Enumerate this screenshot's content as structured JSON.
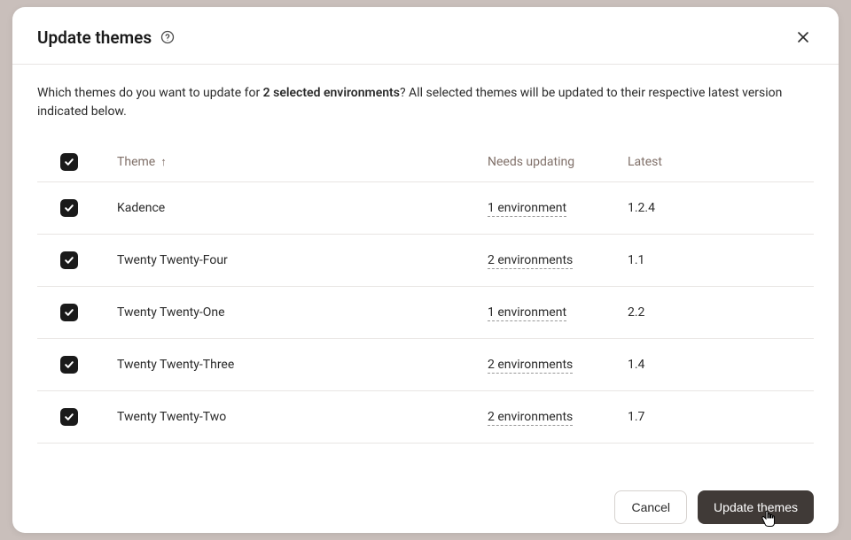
{
  "modal": {
    "title": "Update themes",
    "description_prefix": "Which themes do you want to update for ",
    "description_bold": "2 selected environments",
    "description_suffix": "? All selected themes will be updated to their respective latest version indicated below."
  },
  "table": {
    "headers": {
      "theme": "Theme",
      "needs_updating": "Needs updating",
      "latest": "Latest"
    },
    "rows": [
      {
        "name": "Kadence",
        "needs": "1 environment",
        "latest": "1.2.4"
      },
      {
        "name": "Twenty Twenty-Four",
        "needs": "2 environments",
        "latest": "1.1"
      },
      {
        "name": "Twenty Twenty-One",
        "needs": "1 environment",
        "latest": "2.2"
      },
      {
        "name": "Twenty Twenty-Three",
        "needs": "2 environments",
        "latest": "1.4"
      },
      {
        "name": "Twenty Twenty-Two",
        "needs": "2 environments",
        "latest": "1.7"
      }
    ]
  },
  "footer": {
    "cancel": "Cancel",
    "submit": "Update themes"
  }
}
